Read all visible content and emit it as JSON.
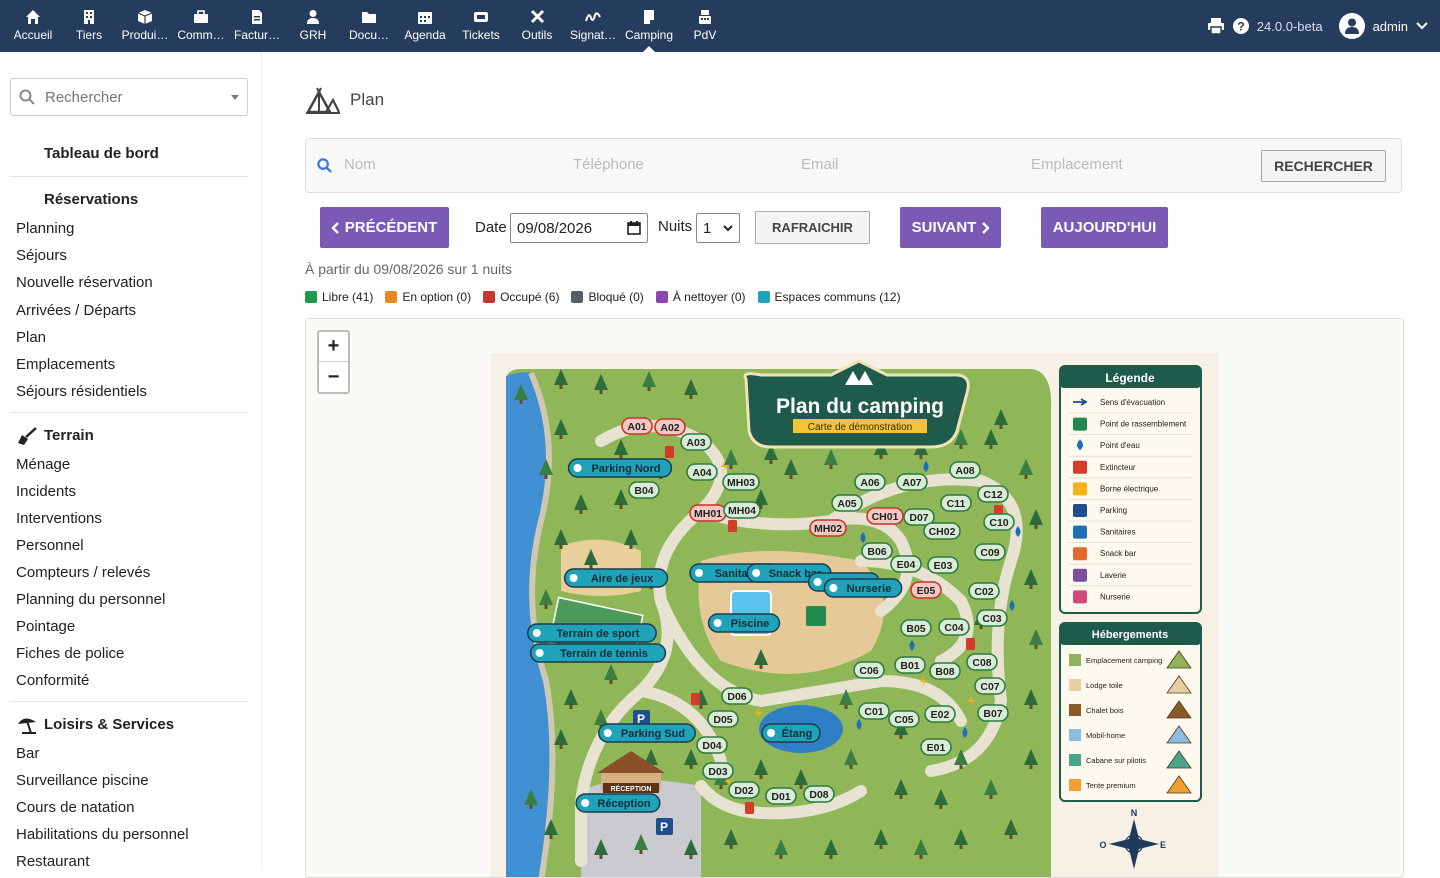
{
  "topbar": {
    "items": [
      {
        "label": "Accueil",
        "icon": "home-icon"
      },
      {
        "label": "Tiers",
        "icon": "building-icon"
      },
      {
        "label": "Produi…",
        "icon": "box-icon"
      },
      {
        "label": "Comm…",
        "icon": "briefcase-icon"
      },
      {
        "label": "Factur…",
        "icon": "invoice-icon"
      },
      {
        "label": "GRH",
        "icon": "user-tie-icon"
      },
      {
        "label": "Docu…",
        "icon": "folder-icon"
      },
      {
        "label": "Agenda",
        "icon": "calendar-icon"
      },
      {
        "label": "Tickets",
        "icon": "ticket-icon"
      },
      {
        "label": "Outils",
        "icon": "tools-icon"
      },
      {
        "label": "Signat…",
        "icon": "signature-icon"
      },
      {
        "label": "Camping",
        "icon": "tent-icon"
      },
      {
        "label": "PdV",
        "icon": "cash-register-icon"
      }
    ],
    "active": "Camping",
    "version": "24.0.0-beta",
    "user": "admin"
  },
  "sidebar": {
    "search_placeholder": "Rechercher",
    "dashboard": "Tableau de bord",
    "reservations": {
      "title": "Réservations",
      "items": [
        "Planning",
        "Séjours",
        "Nouvelle réservation",
        "Arrivées / Départs",
        "Plan",
        "Emplacements",
        "Séjours résidentiels"
      ]
    },
    "terrain": {
      "title": "Terrain",
      "items": [
        "Ménage",
        "Incidents",
        "Interventions",
        "Personnel",
        "Compteurs / relevés",
        "Planning du personnel",
        "Pointage",
        "Fiches de police",
        "Conformité"
      ]
    },
    "loisirs": {
      "title": "Loisirs & Services",
      "items": [
        "Bar",
        "Surveillance piscine",
        "Cours de natation",
        "Habilitations du personnel",
        "Restaurant"
      ]
    }
  },
  "page": {
    "title": "Plan",
    "filters": {
      "nom": "Nom",
      "telephone": "Téléphone",
      "email": "Email",
      "emplacement": "Emplacement",
      "search_button": "RECHERCHER"
    },
    "prev_button": "PRÉCÉDENT",
    "date_label": "Date",
    "date_value": "09/08/2026",
    "nights_label": "Nuits",
    "nights_value": "1",
    "refresh_button": "RAFRAICHIR",
    "next_button": "SUIVANT",
    "today_button": "AUJOURD'HUI",
    "info_text": "À partir du 09/08/2026 sur 1 nuits",
    "status_legend": [
      {
        "label": "Libre (41)",
        "color": "#1f9a4b"
      },
      {
        "label": "En option (0)",
        "color": "#e8891c"
      },
      {
        "label": "Occupé (6)",
        "color": "#c8352a"
      },
      {
        "label": "Bloqué (0)",
        "color": "#555f6b"
      },
      {
        "label": "À nettoyer (0)",
        "color": "#8e44ad"
      },
      {
        "label": "Espaces communs (12)",
        "color": "#1fa3b8"
      }
    ]
  },
  "map": {
    "zoom_in": "+",
    "zoom_out": "−",
    "title": "Plan du camping",
    "subtitle": "Carte de démonstration",
    "legend_title": "Légende",
    "legend_items": [
      {
        "label": "Sens d'évacuation",
        "icon": "arrow-right-icon"
      },
      {
        "label": "Point de rassemblement",
        "icon": "assembly-point-icon"
      },
      {
        "label": "Point d'eau",
        "icon": "water-drop-icon"
      },
      {
        "label": "Extincteur",
        "icon": "extinguisher-icon"
      },
      {
        "label": "Borne électrique",
        "icon": "lightning-icon"
      },
      {
        "label": "Parking",
        "icon": "parking-icon"
      },
      {
        "label": "Sanitaires",
        "icon": "toilets-icon"
      },
      {
        "label": "Snack bar",
        "icon": "cutlery-icon"
      },
      {
        "label": "Laverie",
        "icon": "laundry-icon"
      },
      {
        "label": "Nurserie",
        "icon": "baby-icon"
      }
    ],
    "lodging_title": "Hébergements",
    "lodging_items": [
      {
        "label": "Emplacement camping",
        "color": "#8fb35a"
      },
      {
        "label": "Lodge toile",
        "color": "#e8cfa3"
      },
      {
        "label": "Chalet bois",
        "color": "#8b5a2b"
      },
      {
        "label": "Mobil-home",
        "color": "#8fbbe0"
      },
      {
        "label": "Cabane sur pilotis",
        "color": "#4aa58c"
      },
      {
        "label": "Tente premium",
        "color": "#f0a030"
      }
    ],
    "compass": {
      "n": "N",
      "o": "O",
      "e": "E"
    },
    "places": [
      {
        "label": "Parking Nord",
        "kind": "common"
      },
      {
        "label": "Aire de jeux",
        "kind": "common"
      },
      {
        "label": "Sanitaires",
        "kind": "common"
      },
      {
        "label": "Snack bar",
        "kind": "common"
      },
      {
        "label": "Laverie",
        "kind": "common"
      },
      {
        "label": "Nurserie",
        "kind": "common"
      },
      {
        "label": "Piscine",
        "kind": "common"
      },
      {
        "label": "Terrain de sport",
        "kind": "common"
      },
      {
        "label": "Terrain de tennis",
        "kind": "common"
      },
      {
        "label": "Parking Sud",
        "kind": "common"
      },
      {
        "label": "Étang",
        "kind": "common"
      },
      {
        "label": "Réception",
        "kind": "common"
      }
    ],
    "reception_sign": "RÉCEPTION",
    "spots": [
      {
        "label": "A01",
        "status": "occupied"
      },
      {
        "label": "A02",
        "status": "occupied"
      },
      {
        "label": "A03",
        "status": "free"
      },
      {
        "label": "A04",
        "status": "free"
      },
      {
        "label": "MH03",
        "status": "free"
      },
      {
        "label": "B04",
        "status": "free"
      },
      {
        "label": "MH01",
        "status": "occupied"
      },
      {
        "label": "MH04",
        "status": "free"
      },
      {
        "label": "MH02",
        "status": "occupied"
      },
      {
        "label": "A05",
        "status": "free"
      },
      {
        "label": "A06",
        "status": "free"
      },
      {
        "label": "A07",
        "status": "free"
      },
      {
        "label": "A08",
        "status": "free"
      },
      {
        "label": "C11",
        "status": "free"
      },
      {
        "label": "C12",
        "status": "free"
      },
      {
        "label": "CH01",
        "status": "occupied"
      },
      {
        "label": "D07",
        "status": "free"
      },
      {
        "label": "CH02",
        "status": "free"
      },
      {
        "label": "C10",
        "status": "free"
      },
      {
        "label": "B06",
        "status": "free"
      },
      {
        "label": "C09",
        "status": "free"
      },
      {
        "label": "E04",
        "status": "free"
      },
      {
        "label": "E03",
        "status": "free"
      },
      {
        "label": "E05",
        "status": "occupied"
      },
      {
        "label": "C02",
        "status": "free"
      },
      {
        "label": "C03",
        "status": "free"
      },
      {
        "label": "B05",
        "status": "free"
      },
      {
        "label": "C04",
        "status": "free"
      },
      {
        "label": "C06",
        "status": "free"
      },
      {
        "label": "B01",
        "status": "free"
      },
      {
        "label": "B08",
        "status": "free"
      },
      {
        "label": "C08",
        "status": "free"
      },
      {
        "label": "C07",
        "status": "free"
      },
      {
        "label": "D06",
        "status": "free"
      },
      {
        "label": "D05",
        "status": "free"
      },
      {
        "label": "C01",
        "status": "free"
      },
      {
        "label": "C05",
        "status": "free"
      },
      {
        "label": "E02",
        "status": "free"
      },
      {
        "label": "B07",
        "status": "free"
      },
      {
        "label": "D04",
        "status": "free"
      },
      {
        "label": "E01",
        "status": "free"
      },
      {
        "label": "D03",
        "status": "free"
      },
      {
        "label": "D02",
        "status": "free"
      },
      {
        "label": "D01",
        "status": "free"
      },
      {
        "label": "D08",
        "status": "free"
      }
    ]
  }
}
